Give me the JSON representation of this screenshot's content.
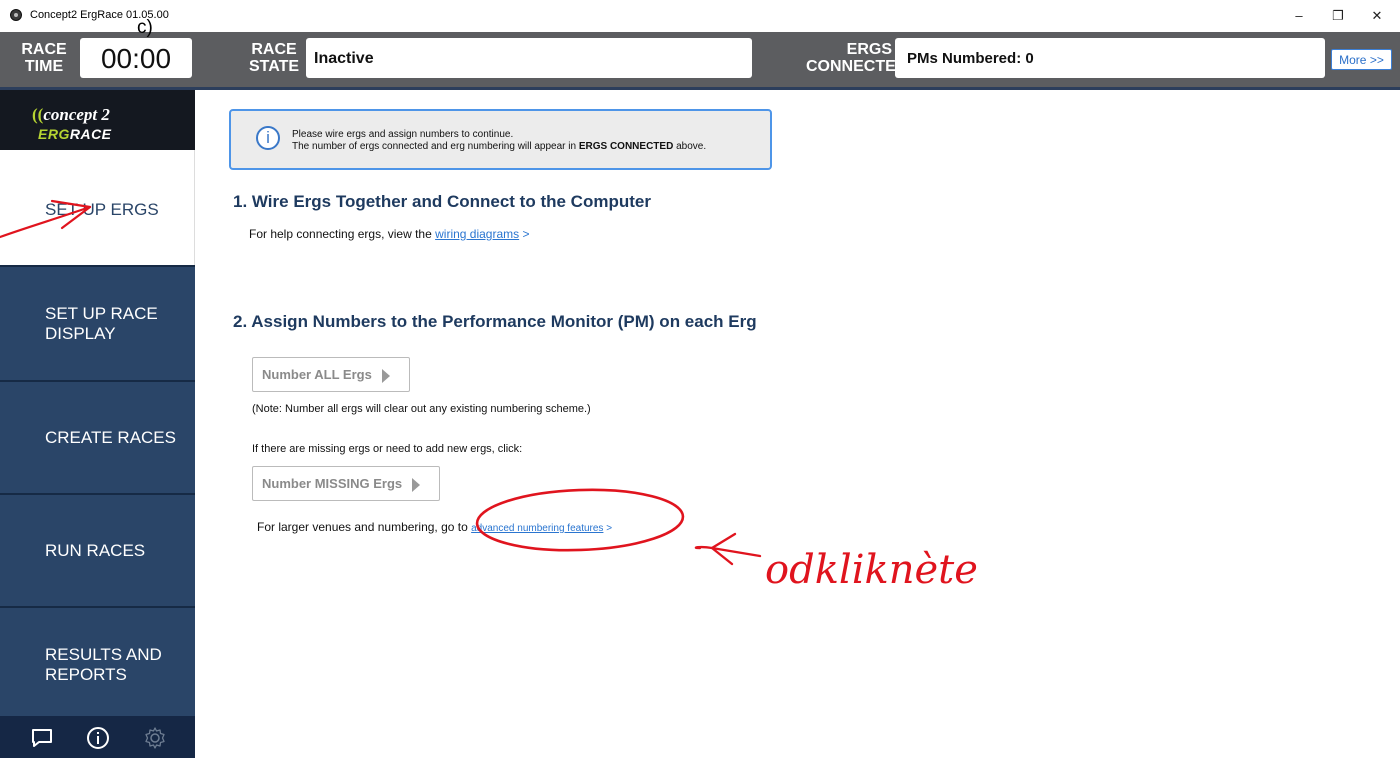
{
  "window": {
    "title": "Concept2 ErgRace 01.05.00",
    "minimize_glyph": "–",
    "restore_glyph": "❐",
    "close_glyph": "✕"
  },
  "header": {
    "race_time_label": [
      "RACE",
      "TIME"
    ],
    "race_time_value": "00:00",
    "race_state_label": [
      "RACE",
      "STATE"
    ],
    "race_state_value": "Inactive",
    "ergs_connected_label": [
      "ERGS",
      "CONNECTED"
    ],
    "ergs_connected_value": "PMs Numbered: 0",
    "more_button": "More >>"
  },
  "sidebar": {
    "logo": {
      "brand": "concept 2",
      "product_erg": "ERG",
      "product_race": "RACE"
    },
    "items": [
      {
        "label": "SET UP ERGS",
        "active": true
      },
      {
        "label": "SET UP RACE DISPLAY",
        "active": false
      },
      {
        "label": "CREATE RACES",
        "active": false
      },
      {
        "label": "RUN RACES",
        "active": false
      },
      {
        "label": "RESULTS AND REPORTS",
        "active": false
      }
    ],
    "bottom_icons": [
      "chat-icon",
      "info-icon",
      "gear-icon"
    ]
  },
  "main": {
    "info": {
      "line1": "Please wire ergs and assign numbers to continue.",
      "line2_prefix": "The number of ergs connected and erg numbering will appear in ",
      "line2_bold": "ERGS CONNECTED",
      "line2_suffix": " above."
    },
    "section1": {
      "heading": "1. Wire Ergs Together and Connect to the Computer",
      "text": "For help connecting ergs, view the ",
      "link": "wiring diagrams",
      "link_suffix": " >"
    },
    "section2": {
      "heading": "2. Assign Numbers to the Performance Monitor (PM) on each Erg",
      "number_all_button": "Number ALL Ergs",
      "note": "(Note: Number all ergs will clear out any existing numbering scheme.)",
      "missing_text": "If there are missing ergs or need to add new ergs, click:",
      "number_missing_button": "Number MISSING Ergs",
      "advanced_text": "For larger venues and numbering, go to ",
      "advanced_link": "advanced numbering features",
      "advanced_suffix": " >"
    }
  },
  "annotations": {
    "handwritten_letter": "c)",
    "handwritten_note": "odkliknète",
    "ink_color": "#e0141e"
  },
  "colors": {
    "header_bg": "#5c5d60",
    "sidebar_bg": "#2a4568",
    "heading": "#1e3a5f",
    "link": "#2a75d0",
    "logo_green": "#b6d432"
  }
}
